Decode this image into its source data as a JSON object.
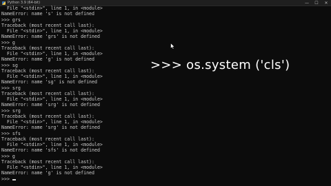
{
  "window": {
    "title": "Python 3.9 (64-bit)",
    "minimize_label": "—",
    "maximize_label": "☐",
    "close_label": "✕"
  },
  "console": {
    "lines": [
      "  File \"<stdin>\", line 1, in <module>",
      "NameError: name 's' is not defined",
      ">>> grs",
      "Traceback (most recent call last):",
      "  File \"<stdin>\", line 1, in <module>",
      "NameError: name 'grs' is not defined",
      ">>> g",
      "Traceback (most recent call last):",
      "  File \"<stdin>\", line 1, in <module>",
      "NameError: name 'g' is not defined",
      ">>> sg",
      "Traceback (most recent call last):",
      "  File \"<stdin>\", line 1, in <module>",
      "NameError: name 'sg' is not defined",
      ">>> srg",
      "Traceback (most recent call last):",
      "  File \"<stdin>\", line 1, in <module>",
      "NameError: name 'srg' is not defined",
      ">>> srg",
      "Traceback (most recent call last):",
      "  File \"<stdin>\", line 1, in <module>",
      "NameError: name 'srg' is not defined",
      ">>> sfs",
      "Traceback (most recent call last):",
      "  File \"<stdin>\", line 1, in <module>",
      "NameError: name 'sfs' is not defined",
      ">>> g",
      "Traceback (most recent call last):",
      "  File \"<stdin>\", line 1, in <module>",
      "NameError: name 'g' is not defined"
    ],
    "prompt": ">>>"
  },
  "overlay": {
    "text": ">>> os.system ('cls')"
  },
  "icons": {
    "app": "python-icon",
    "pointer": "mouse-pointer-icon"
  }
}
